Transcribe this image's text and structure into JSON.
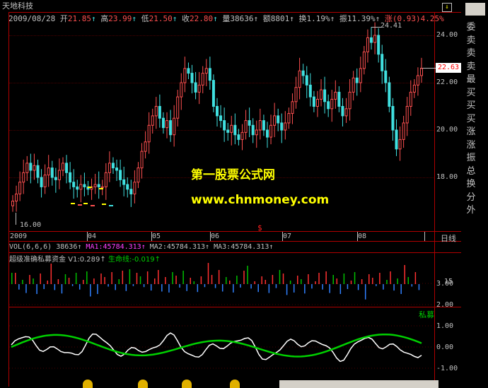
{
  "header": {
    "name": "天地科技",
    "date": "2009/08/28",
    "open_label": "开",
    "open": "21.85",
    "high_label": "高",
    "high": "23.99",
    "low_label": "低",
    "low": "21.50",
    "close_label": "收",
    "close": "22.80",
    "volume_label": "量",
    "volume": "38636",
    "amount_label": "额",
    "amount": "8801",
    "turnover_label": "换",
    "turnover": "1.19%",
    "amplitude_label": "振",
    "amplitude": "11.39%",
    "change_label": "涨",
    "change": "(0.93)4.25%"
  },
  "price_axis": [
    "24.00",
    "22.00",
    "20.00",
    "18.00"
  ],
  "current_price": "22.63",
  "max_marker": "24.41",
  "min_marker": "16.00",
  "time_axis": {
    "labels": [
      "2009",
      "04",
      "05",
      "06",
      "07",
      "08"
    ],
    "period": "日线",
    "special_marker": "$"
  },
  "volume_panel": {
    "title": "VOL(6,6,6)",
    "value": "38636",
    "ma1": "MA1:45784.313",
    "ma2": "MA2:45784.313",
    "ma3": "MA3:45784.313"
  },
  "indicator_panel": {
    "title": "超级准确私募资金",
    "v1": "V1:0.289",
    "lifeline": "生命线:-0.019",
    "label": "私募",
    "axis": [
      "3.00",
      "2.00",
      "1.00",
      "0.00",
      "-1.00"
    ],
    "right_num": "15"
  },
  "watermark": {
    "line1": "第一股票公式网",
    "line2": "www.chnmoney.com"
  },
  "right_toolbar": [
    "委",
    "卖",
    "卖",
    "卖",
    "最",
    "买",
    "买",
    "买",
    "涨",
    "涨",
    "振",
    "总",
    "换",
    "分",
    "外"
  ],
  "colors": {
    "up": "#ff5050",
    "down": "#40e0e0",
    "axis": "#b00000",
    "magenta": "#ff40ff",
    "green": "#00d000",
    "yellow": "#ffff00",
    "white": "#ffffff"
  }
}
